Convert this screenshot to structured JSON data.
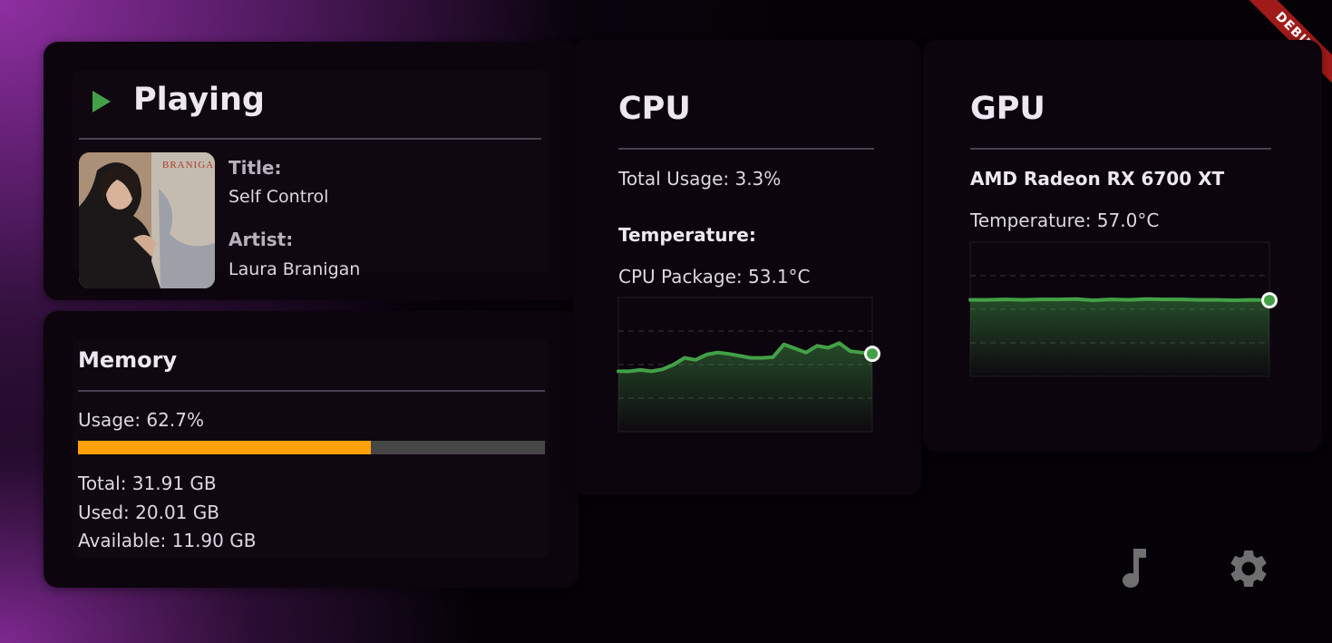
{
  "debug_banner": "DEBUG",
  "now_playing": {
    "status": "Playing",
    "title_label": "Title:",
    "title": "Self Control",
    "artist_label": "Artist:",
    "artist": "Laura Branigan",
    "album_art_text": "BRANIGAN"
  },
  "memory": {
    "title": "Memory",
    "usage_text": "Usage: 62.7%",
    "usage_percent": 62.7,
    "total_text": "Total: 31.91 GB",
    "used_text": "Used: 20.01 GB",
    "available_text": "Available: 11.90 GB",
    "bar_color": "#ffa10a"
  },
  "cpu": {
    "title": "CPU",
    "total_usage": "Total Usage: 3.3%",
    "temperature_label": "Temperature:",
    "package_temp": "CPU Package: 53.1°C",
    "history": [
      49,
      49,
      49.2,
      49,
      49.3,
      50,
      51,
      50.7,
      51.5,
      51.8,
      51.6,
      51.3,
      51,
      51,
      51.1,
      53,
      52.4,
      51.8,
      52.8,
      52.5,
      53.2,
      52,
      51.8,
      51.6
    ],
    "y_range": [
      40,
      60
    ],
    "line_color": "#43a047"
  },
  "gpu": {
    "title": "GPU",
    "name": "AMD Radeon RX 6700 XT",
    "temperature": "Temperature: 57.0°C",
    "history": [
      57.1,
      57.1,
      57.2,
      57.1,
      57.2,
      57.2,
      57.3,
      57.0,
      57.2,
      57.1,
      57.3,
      57.2,
      57.2,
      57.1,
      57.1,
      57.0,
      57.1,
      57.0
    ],
    "y_range": [
      40,
      70
    ],
    "line_color": "#43a047"
  },
  "icons": {
    "play": "play-icon",
    "music": "music-note-icon",
    "settings": "gear-icon"
  }
}
